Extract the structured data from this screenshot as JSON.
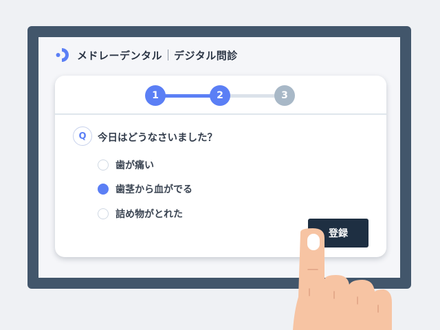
{
  "header": {
    "brand": "メドレーデンタル",
    "subtitle": "デジタル問診",
    "logo_icon": "logo-icon"
  },
  "stepper": {
    "steps": [
      "1",
      "2",
      "3"
    ],
    "current": 2,
    "total": 3
  },
  "question": {
    "badge": "Q",
    "text": "今日はどうなさいました？"
  },
  "options": [
    {
      "label": "歯が痛い",
      "checked": false
    },
    {
      "label": "歯茎から血がでる",
      "checked": true
    },
    {
      "label": "詰め物がとれた",
      "checked": false
    }
  ],
  "submit_label": "登録",
  "colors": {
    "accent": "#5b7ff5",
    "device_frame": "#42566b",
    "button": "#1e2f42",
    "step_inactive": "#a8b8c7"
  }
}
